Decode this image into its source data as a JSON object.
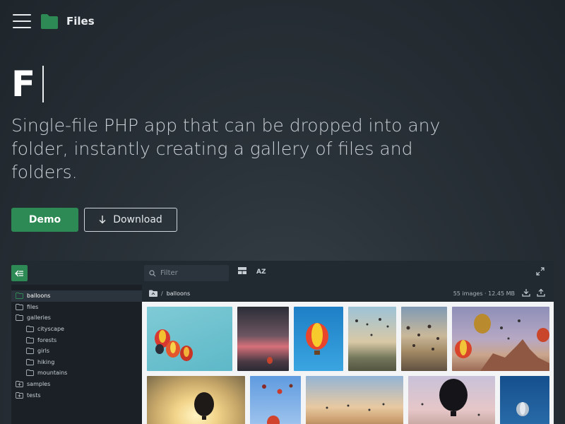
{
  "nav": {
    "brand": "Files",
    "menu_icon": "hamburger-icon",
    "logo_icon": "folder-icon"
  },
  "hero": {
    "title": "F",
    "tagline": "Single-file PHP app that can be dropped into any folder, instantly creating a gallery of files and folders.",
    "demo_label": "Demo",
    "download_label": "Download",
    "download_icon": "arrow-down-icon"
  },
  "colors": {
    "accent": "#2e8a54",
    "background": "#242c33",
    "panel": "#1f262c"
  },
  "app": {
    "filter_placeholder": "Filter",
    "sort_label": "AZ",
    "sidebar": [
      {
        "label": "balloons",
        "depth": 0,
        "icon": "folder-icon",
        "active": true
      },
      {
        "label": "files",
        "depth": 0,
        "icon": "folder-icon",
        "active": false
      },
      {
        "label": "galleries",
        "depth": 0,
        "icon": "folder-icon",
        "active": false
      },
      {
        "label": "cityscape",
        "depth": 1,
        "icon": "folder-icon",
        "active": false
      },
      {
        "label": "forests",
        "depth": 1,
        "icon": "folder-icon",
        "active": false
      },
      {
        "label": "girls",
        "depth": 1,
        "icon": "folder-icon",
        "active": false
      },
      {
        "label": "hiking",
        "depth": 1,
        "icon": "folder-icon",
        "active": false
      },
      {
        "label": "mountains",
        "depth": 1,
        "icon": "folder-icon",
        "active": false
      },
      {
        "label": "samples",
        "depth": 0,
        "icon": "folder-plus-icon",
        "active": false
      },
      {
        "label": "tests",
        "depth": 0,
        "icon": "folder-plus-icon",
        "active": false
      }
    ],
    "breadcrumb": {
      "sep": "/",
      "current": "balloons"
    },
    "meta": {
      "count": "55 images",
      "size": "12.45 MB"
    },
    "thumbnails": [
      "balloons-sky-thumbnail",
      "balloon-sunset-thumbnail",
      "balloon-blue-sky-thumbnail",
      "balloons-valley-thumbnail",
      "balloons-dawn-thumbnail",
      "balloons-cappadocia-thumbnail",
      "balloon-sun-silhouette-thumbnail",
      "balloons-cloudy-thumbnail",
      "balloons-horizon-thumbnail",
      "balloon-dusk-silhouette-thumbnail",
      "balloon-blue-thumbnail"
    ]
  }
}
